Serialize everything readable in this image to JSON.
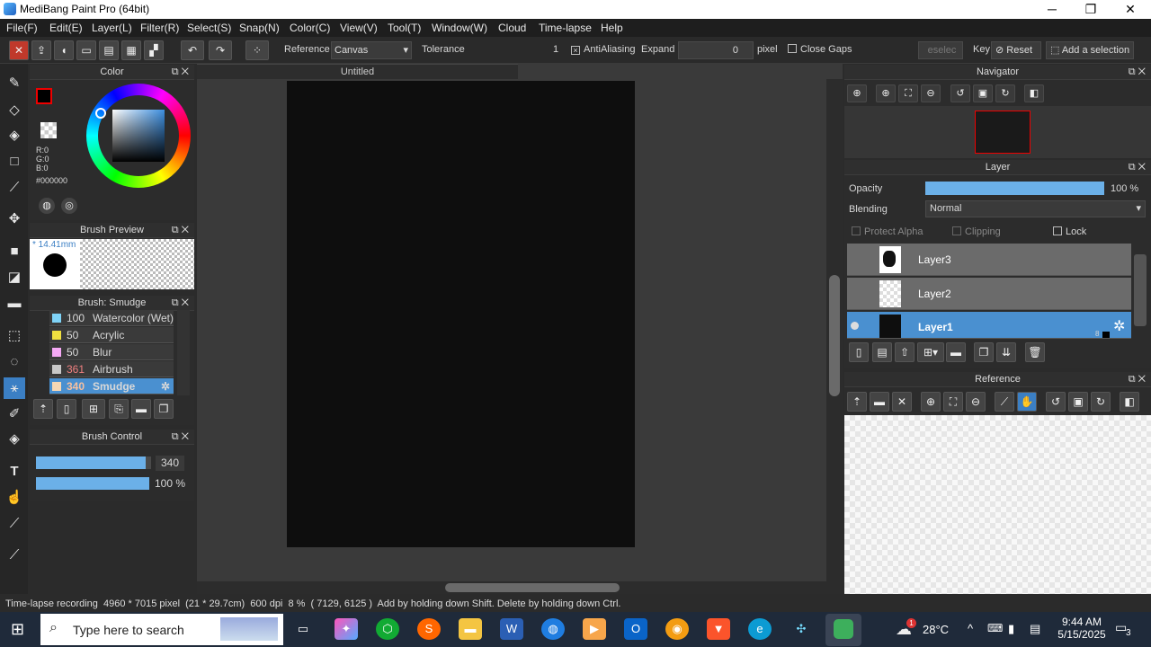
{
  "window": {
    "title": "MediBang Paint Pro (64bit)",
    "minimize": "─",
    "maximize": "❐",
    "close": "✕"
  },
  "menu": [
    "File(F)",
    "Edit(E)",
    "Layer(L)",
    "Filter(R)",
    "Select(S)",
    "Snap(N)",
    "Color(C)",
    "View(V)",
    "Tool(T)",
    "Window(W)",
    "Cloud",
    "Time-lapse",
    "Help"
  ],
  "toolbar": {
    "reference_label": "Reference",
    "reference_value": "Canvas",
    "tolerance_label": "Tolerance",
    "tolerance_value": "1",
    "antialiasing_label": "AntiAliasing",
    "expand_label": "Expand",
    "expand_value": "0",
    "pixel_label": "pixel",
    "close_gaps_label": "Close Gaps",
    "deselect_label": "eselec",
    "key_label": "Key",
    "reset_label": "Reset",
    "add_selection_label": "Add a selection"
  },
  "color_panel": {
    "title": "Color",
    "r": "R:0",
    "g": "G:0",
    "b": "B:0",
    "hex": "#000000"
  },
  "brush_preview": {
    "title": "Brush Preview",
    "size": "* 14.41mm"
  },
  "brush_panel": {
    "title": "Brush: Smudge",
    "items": [
      {
        "size": "100",
        "name": "Watercolor (Wet)",
        "color": "#7fd3f7"
      },
      {
        "size": "50",
        "name": "Acrylic",
        "color": "#f0e040"
      },
      {
        "size": "50",
        "name": "Blur",
        "color": "#f5a9f5"
      },
      {
        "size": "361",
        "name": "Airbrush",
        "color": "#c8c8c8"
      },
      {
        "size": "340",
        "name": "Smudge",
        "color": "#f6d7b4"
      }
    ]
  },
  "brush_control": {
    "title": "Brush Control",
    "size_value": "340",
    "opacity_value": "100 %",
    "size_fill": 0.95,
    "opacity_fill": 1.0
  },
  "document": {
    "tab": "Untitled"
  },
  "status": {
    "text": "Time-lapse recording  4960 * 7015 pixel  (21 * 29.7cm)  600 dpi  8 %  ( 7129, 6125 )  Add by holding down Shift. Delete by holding down Ctrl."
  },
  "navigator": {
    "title": "Navigator"
  },
  "layer_panel": {
    "title": "Layer",
    "opacity_label": "Opacity",
    "opacity_value": "100 %",
    "opacity_fill": 1.0,
    "blending_label": "Blending",
    "blending_value": "Normal",
    "protect_alpha": "Protect Alpha",
    "clipping": "Clipping",
    "lock": "Lock",
    "layers": [
      "Layer3",
      "Layer2",
      "Layer1"
    ],
    "selected_layer_number": "8"
  },
  "reference_panel": {
    "title": "Reference"
  },
  "taskbar": {
    "search_placeholder": "Type here to search",
    "temperature": "28°C",
    "time": "9:44 AM",
    "date": "5/15/2025",
    "notifications": "3",
    "weather_badge": "1"
  }
}
